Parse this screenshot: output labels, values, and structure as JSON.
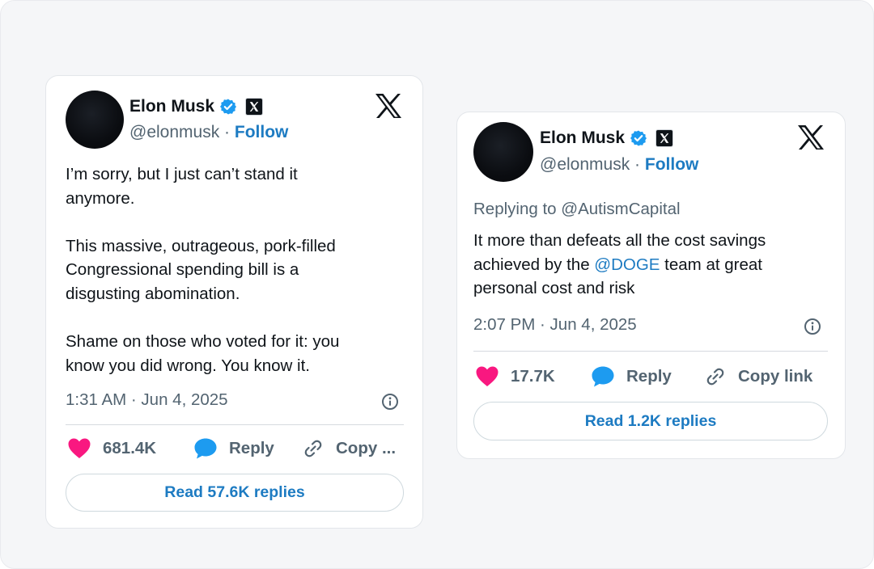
{
  "colors": {
    "link_blue": "#1d7bc2",
    "verified_blue": "#1d9bf0",
    "like_pink": "#f91880",
    "reply_blue": "#1d9bf0",
    "muted_gray": "#536471"
  },
  "tweets": [
    {
      "author_name": "Elon Musk",
      "handle": "@elonmusk",
      "separator": "·",
      "follow_label": "Follow",
      "reply_to": null,
      "text": "I’m sorry, but I just can’t stand it\nanymore.\n\nThis massive, outrageous, pork-filled\nCongressional spending bill is a\ndisgusting abomination.\n\nShame on those who voted for it: you\nknow you did wrong. You know it.",
      "timestamp": "1:31 AM · Jun 4, 2025",
      "likes": "681.4K",
      "reply_label": "Reply",
      "copy_label": "Copy ...",
      "read_replies": "Read 57.6K replies",
      "icons": [
        "verified-badge-icon",
        "x-affiliate-icon",
        "x-logo-icon",
        "info-icon",
        "heart-icon",
        "reply-bubble-icon",
        "link-icon"
      ]
    },
    {
      "author_name": "Elon Musk",
      "handle": "@elonmusk",
      "separator": "·",
      "follow_label": "Follow",
      "reply_to": "Replying to @AutismCapital",
      "text_before": "It more than defeats all the cost savings\nachieved by the ",
      "mention": "@DOGE",
      "text_after": " team at great\npersonal cost and risk",
      "timestamp": "2:07 PM · Jun 4, 2025",
      "likes": "17.7K",
      "reply_label": "Reply",
      "copy_label": "Copy link",
      "read_replies": "Read 1.2K replies",
      "icons": [
        "verified-badge-icon",
        "x-affiliate-icon",
        "x-logo-icon",
        "info-icon",
        "heart-icon",
        "reply-bubble-icon",
        "link-icon"
      ]
    }
  ]
}
